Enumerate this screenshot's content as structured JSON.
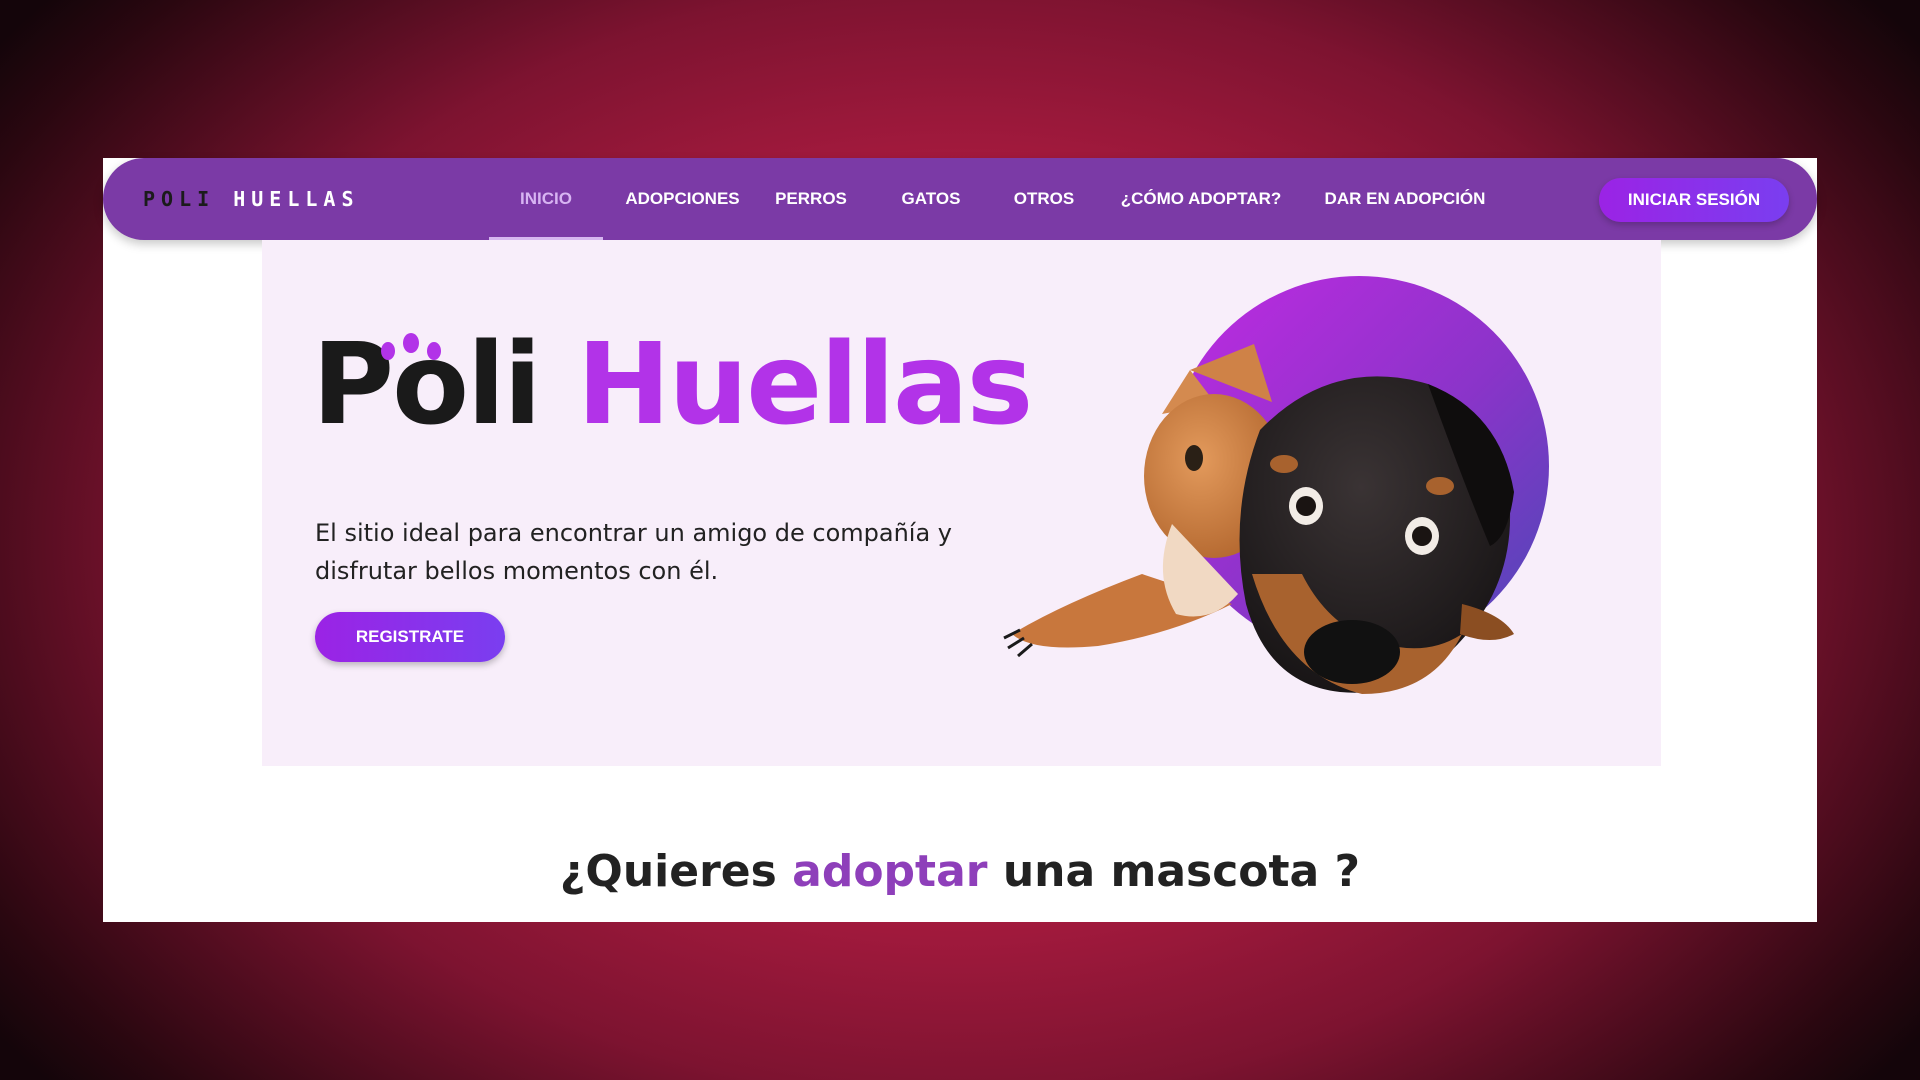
{
  "header": {
    "logo": {
      "part1": "POLI",
      "part2": "HUELLAS"
    },
    "nav": [
      {
        "label": "INICIO",
        "active": true
      },
      {
        "label": "ADOPCIONES",
        "active": false
      },
      {
        "label": "PERROS",
        "active": false
      },
      {
        "label": "GATOS",
        "active": false
      },
      {
        "label": "OTROS",
        "active": false
      },
      {
        "label": "¿CÓMO ADOPTAR?",
        "active": false
      },
      {
        "label": "DAR EN ADOPCIÓN",
        "active": false
      }
    ],
    "login_label": "INICIAR SESIÓN"
  },
  "hero": {
    "title_part1": "Poli",
    "title_part2": "Huellas",
    "description": "El sitio ideal para encontrar un amigo de compañía y disfrutar bellos momentos con él.",
    "register_label": "REGISTRATE",
    "image_icon": "cat-and-dog-image"
  },
  "section": {
    "heading_prefix": "¿Quieres",
    "heading_accent": "adoptar",
    "heading_suffix": "una mascota ?"
  },
  "colors": {
    "navbar": "#7b3aa6",
    "accent": "#b233e8",
    "button_gradient_start": "#9b23e5",
    "button_gradient_end": "#7a3ef0",
    "hero_bg": "#f8eefa",
    "page_bg": "#c71e4a"
  }
}
